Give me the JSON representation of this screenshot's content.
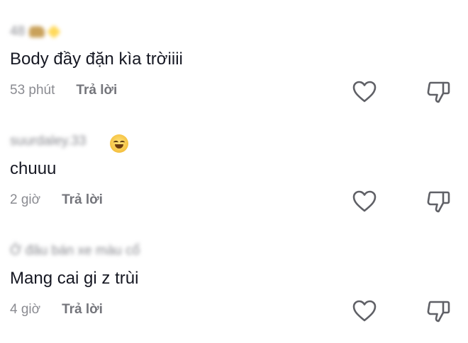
{
  "comments": [
    {
      "username": "48",
      "text": "Body đầy đặn kìa trờiiii",
      "time": "53 phút",
      "reply_label": "Trả lời"
    },
    {
      "username": "suurdaley.33",
      "text": "chuuu",
      "time": "2 giờ",
      "reply_label": "Trả lời"
    },
    {
      "username": "Ở đâu bán xe màu cổ",
      "text": "Mang cai gi z trùi",
      "time": "4 giờ",
      "reply_label": "Trả lời"
    }
  ],
  "icons": {
    "like": "heart-outline-icon",
    "dislike": "thumbs-down-outline-icon"
  },
  "colors": {
    "text": "#161823",
    "secondary": "#8a8b91",
    "icon": "#5f6066"
  }
}
